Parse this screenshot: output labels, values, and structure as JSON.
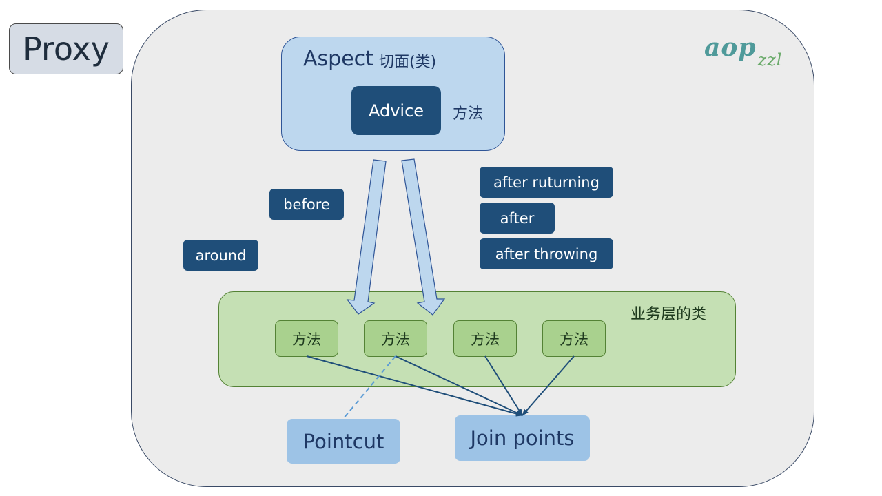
{
  "proxy": {
    "label": "Proxy"
  },
  "watermark": {
    "main": "aop",
    "sub": "zzl"
  },
  "aspect": {
    "title": "Aspect",
    "subtitle": "切面(类)",
    "advice_label": "Advice",
    "advice_method": "方法"
  },
  "advice_types": {
    "before": "before",
    "around": "around",
    "after_returning": "after ruturning",
    "after": "after",
    "after_throwing": "after throwing"
  },
  "business": {
    "label": "业务层的类",
    "methods": [
      "方法",
      "方法",
      "方法",
      "方法"
    ]
  },
  "pointcut": {
    "label": "Pointcut"
  },
  "join_points": {
    "label": "Join points"
  },
  "colors": {
    "dark_blue": "#1f4e79",
    "light_blue": "#bdd7ee",
    "green": "#c5e0b4",
    "method_green": "#a9d18e",
    "connector": "#1f4e79",
    "dashed_connector": "#5b9bd5"
  }
}
